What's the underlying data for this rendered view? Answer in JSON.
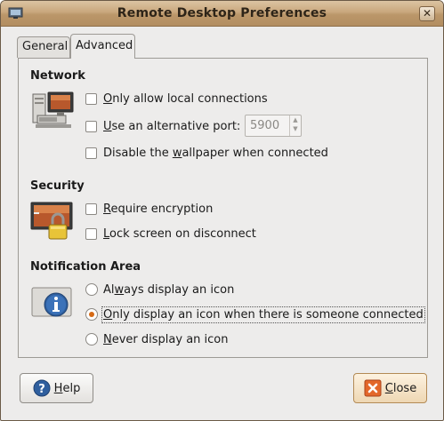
{
  "window": {
    "title": "Remote Desktop Preferences",
    "close_glyph": "✕"
  },
  "tabs": [
    {
      "label": "General"
    },
    {
      "label": "Advanced"
    }
  ],
  "network": {
    "title": "Network",
    "only_local": {
      "pre": "",
      "key": "O",
      "post": "nly allow local connections",
      "checked": false
    },
    "alt_port": {
      "pre": "",
      "key": "U",
      "post": "se an alternative port:",
      "checked": false
    },
    "port_value": "5900",
    "disable_wallpaper": {
      "pre": "Disable the ",
      "key": "w",
      "post": "allpaper when connected",
      "checked": false
    }
  },
  "security": {
    "title": "Security",
    "require_encryption": {
      "pre": "",
      "key": "R",
      "post": "equire encryption",
      "checked": false
    },
    "lock_screen": {
      "pre": "",
      "key": "L",
      "post": "ock screen on disconnect",
      "checked": false
    }
  },
  "notification": {
    "title": "Notification Area",
    "always": {
      "pre": "Al",
      "key": "w",
      "post": "ays display an icon",
      "selected": false
    },
    "only_connected": {
      "pre": "",
      "key": "O",
      "post": "nly display an icon when there is someone connected",
      "selected": true
    },
    "never": {
      "pre": "",
      "key": "N",
      "post": "ever display an icon",
      "selected": false
    }
  },
  "buttons": {
    "help": {
      "pre": "",
      "key": "H",
      "post": "elp"
    },
    "close": {
      "pre": "",
      "key": "C",
      "post": "lose"
    }
  },
  "colors": {
    "titlebar": "#c9a77d",
    "radio_selected": "#d66a16",
    "close_icon": "#e3672a",
    "help_icon": "#2f5f9e"
  },
  "icons": {
    "app": "monitor-icon",
    "network": "network-computers-icon",
    "security": "lock-screen-icon",
    "notification": "info-icon",
    "help": "help-icon",
    "close": "close-x-icon"
  }
}
